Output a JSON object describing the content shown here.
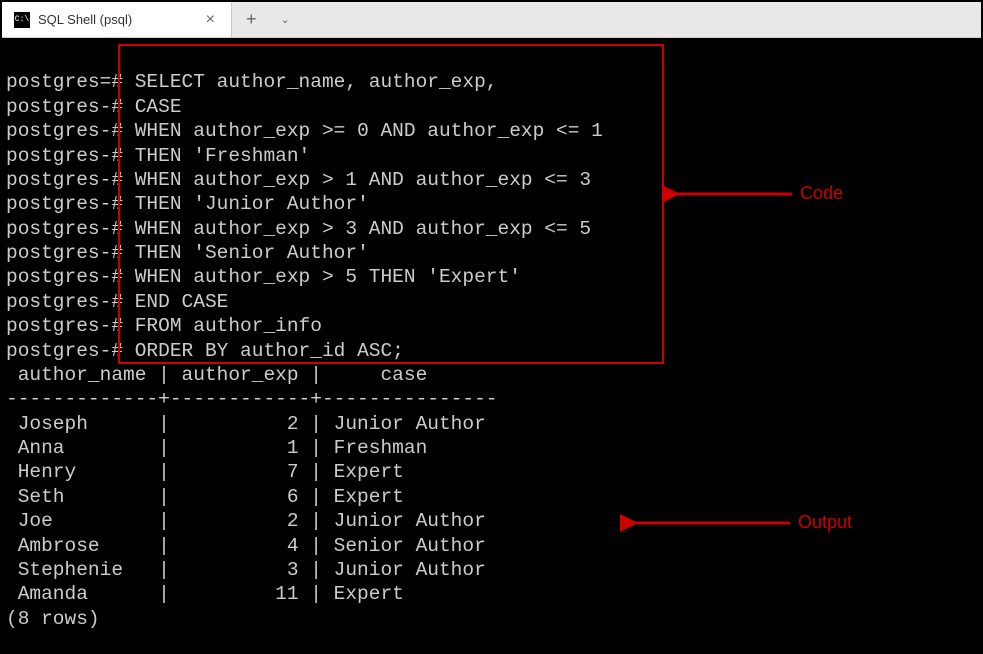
{
  "window": {
    "tab_title": "SQL Shell (psql)"
  },
  "prompts": {
    "main": "postgres=#",
    "cont": "postgres-#"
  },
  "sql_lines": [
    "SELECT author_name, author_exp,",
    "CASE",
    "WHEN author_exp >= 0 AND author_exp <= 1",
    "THEN 'Freshman'",
    "WHEN author_exp > 1 AND author_exp <= 3",
    "THEN 'Junior Author'",
    "WHEN author_exp > 3 AND author_exp <= 5",
    "THEN 'Senior Author'",
    "WHEN author_exp > 5 THEN 'Expert'",
    "END CASE",
    "FROM author_info",
    "ORDER BY author_id ASC;"
  ],
  "table": {
    "header_line": " author_name | author_exp |     case",
    "divider_line": "-------------+------------+---------------",
    "rows": [
      " Joseph      |          2 | Junior Author",
      " Anna        |          1 | Freshman",
      " Henry       |          7 | Expert",
      " Seth        |          6 | Expert",
      " Joe         |          2 | Junior Author",
      " Ambrose     |          4 | Senior Author",
      " Stephenie   |          3 | Junior Author",
      " Amanda      |         11 | Expert"
    ],
    "footer": "(8 rows)"
  },
  "annotations": {
    "code_label": "Code",
    "output_label": "Output"
  }
}
